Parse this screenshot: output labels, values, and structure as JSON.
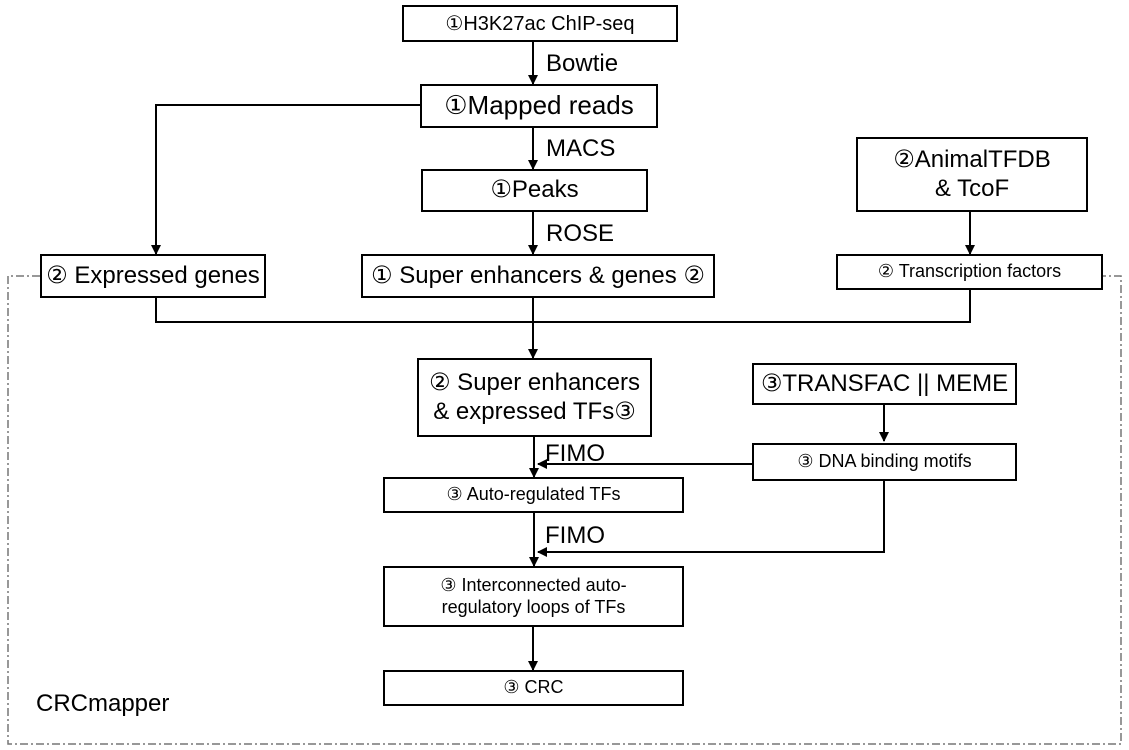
{
  "diagram": {
    "title": "CRCmapper",
    "nodes": {
      "chipseq": "①H3K27ac ChIP-seq",
      "mapped": "①Mapped reads",
      "peaks": "①Peaks",
      "animaltfdb_line1": "②AnimalTFDB",
      "animaltfdb_line2": "& TcoF",
      "expressed": "② Expressed genes",
      "superenh": "① Super enhancers & genes ②",
      "tfs": "② Transcription factors",
      "se_tfs_line1": "② Super enhancers",
      "se_tfs_line2": "& expressed TFs③",
      "transfac": "③TRANSFAC || MEME",
      "motifs": "③ DNA binding motifs",
      "autoreg": "③ Auto-regulated TFs",
      "loops_line1": "③ Interconnected auto-",
      "loops_line2": "regulatory loops of TFs",
      "crc": "③ CRC"
    },
    "edge_labels": {
      "bowtie": "Bowtie",
      "macs": "MACS",
      "rose": "ROSE",
      "fimo1": "FIMO",
      "fimo2": "FIMO"
    }
  }
}
